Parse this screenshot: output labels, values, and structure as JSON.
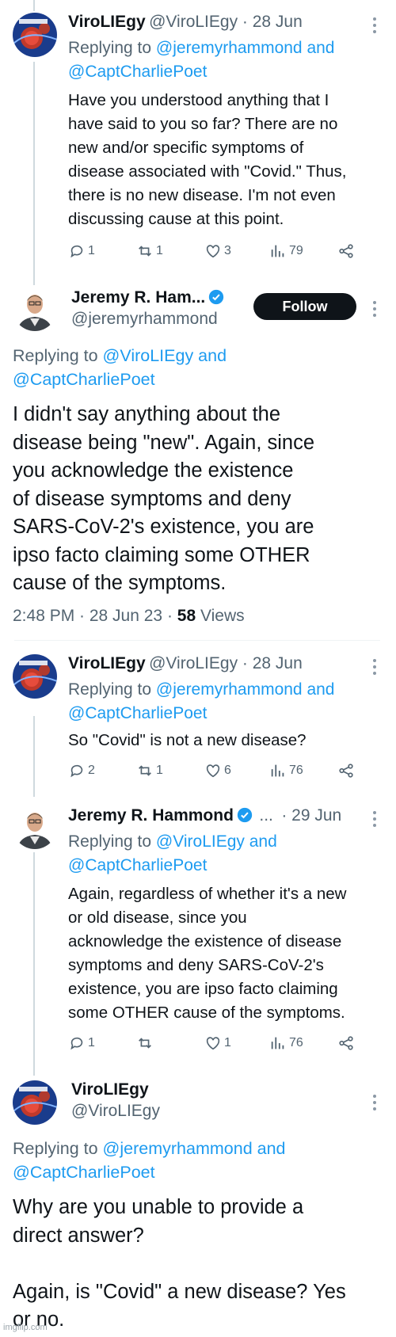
{
  "tweet1": {
    "name": "ViroLIEgy",
    "handle_date": "@ViroLIEgy · 28 Jun",
    "replying_prefix": "Replying to ",
    "mention1": "@jeremyrhammond and",
    "mention2": "@CaptCharliePoet",
    "body_lines": [
      "Have you understood anything that I",
      "have said to you so far? There are no",
      "new and/or specific symptoms of",
      "disease associated with \"Covid.\" Thus,",
      "there is no new disease. I'm not even",
      "discussing cause at this point."
    ],
    "replies": "1",
    "retweets": "1",
    "likes": "3",
    "views": "79"
  },
  "tweet2": {
    "name": "Jeremy R. Ham...",
    "handle": "@jeremyrhammond",
    "follow_label": "Follow",
    "replying_prefix": "Replying to ",
    "mention1": "@ViroLIEgy and",
    "mention2": "@CaptCharliePoet",
    "body_lines": [
      "I didn't say anything about the",
      "disease being \"new\". Again, since",
      "you acknowledge the existence",
      "of disease symptoms and deny",
      "SARS-CoV-2's existence, you are",
      "ipso facto claiming some OTHER",
      "cause of the symptoms."
    ],
    "timestamp": "2:48 PM · 28 Jun 23 · ",
    "views_count": "58",
    "views_label": " Views"
  },
  "tweet3": {
    "name": "ViroLIEgy",
    "handle_date": "@ViroLIEgy · 28 Jun",
    "replying_prefix": "Replying to ",
    "mention1": "@jeremyrhammond and",
    "mention2": "@CaptCharliePoet",
    "body_lines": [
      "So \"Covid\" is not a new disease?"
    ],
    "replies": "2",
    "retweets": "1",
    "likes": "6",
    "views": "76"
  },
  "tweet4": {
    "name": "Jeremy R. Hammond",
    "ellipsis": "...",
    "date": "· 29 Jun",
    "replying_prefix": "Replying to ",
    "mention1": "@ViroLIEgy and",
    "mention2": "@CaptCharliePoet",
    "body_lines": [
      "Again, regardless of whether it's a new",
      "or old disease, since you",
      "acknowledge the existence of disease",
      "symptoms and deny SARS-CoV-2's",
      "existence, you are ipso facto claiming",
      "some OTHER cause of the symptoms."
    ],
    "replies": "1",
    "retweets": "",
    "likes": "1",
    "views": "76"
  },
  "tweet5": {
    "name": "ViroLIEgy",
    "handle": "@ViroLIEgy",
    "replying_prefix": "Replying to ",
    "mention1": "@jeremyrhammond and",
    "mention2": "@CaptCharliePoet",
    "body_lines": [
      "Why are you unable to provide a",
      "direct answer?",
      "",
      "Again, is \"Covid\" a new disease? Yes",
      "or no."
    ]
  },
  "watermark": "imgflip.com",
  "colors": {
    "link": "#1d9bf0",
    "secondary": "#536471",
    "verified": "#1d9bf0",
    "text": "#0f1419"
  }
}
